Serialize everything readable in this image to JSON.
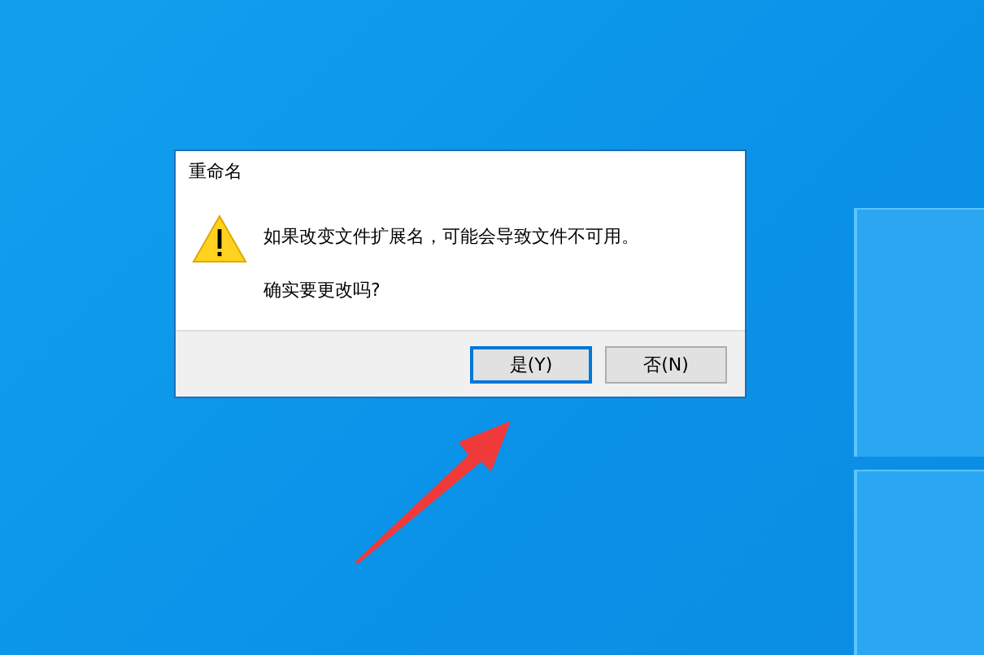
{
  "dialog": {
    "title": "重命名",
    "message": "如果改变文件扩展名，可能会导致文件不可用。",
    "question": "确实要更改吗?",
    "buttons": [
      {
        "label": "是(Y)",
        "default": true
      },
      {
        "label": "否(N)",
        "default": false
      }
    ]
  }
}
